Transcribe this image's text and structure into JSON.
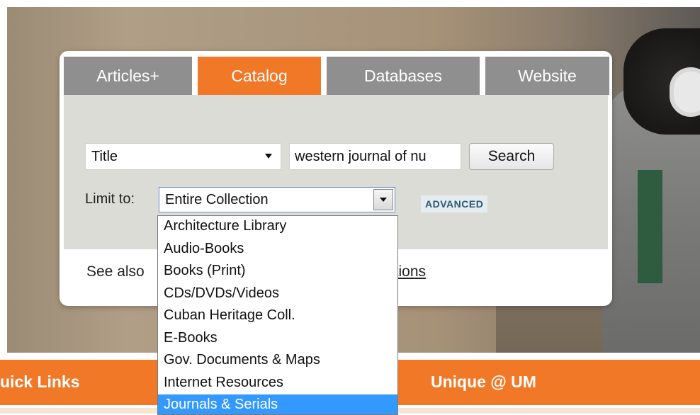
{
  "tabs": [
    {
      "label": "Articles+",
      "active": false
    },
    {
      "label": "Catalog",
      "active": true
    },
    {
      "label": "Databases",
      "active": false
    },
    {
      "label": "Website",
      "active": false
    }
  ],
  "search": {
    "field_select_value": "Title",
    "query_value": "western journal of nu",
    "button_label": "Search"
  },
  "limit": {
    "label": "Limit to:",
    "selected": "Entire Collection",
    "advanced_label": "ADVANCED",
    "options": [
      "Architecture Library",
      "Audio-Books",
      "Books (Print)",
      "CDs/DVDs/Videos",
      "Cuban Heritage Coll.",
      "E-Books",
      "Gov. Documents & Maps",
      "Internet Resources",
      "Journals & Serials"
    ],
    "highlighted_option": "Journals & Serials"
  },
  "see_also": {
    "prefix": "See also",
    "link_suffix": "itions"
  },
  "footer": {
    "quick_links": "uick Links",
    "unique": "Unique @ UM"
  },
  "colors": {
    "accent_orange": "#f07827",
    "tab_gray": "#8f8f8f",
    "highlight_blue": "#3399ff"
  }
}
